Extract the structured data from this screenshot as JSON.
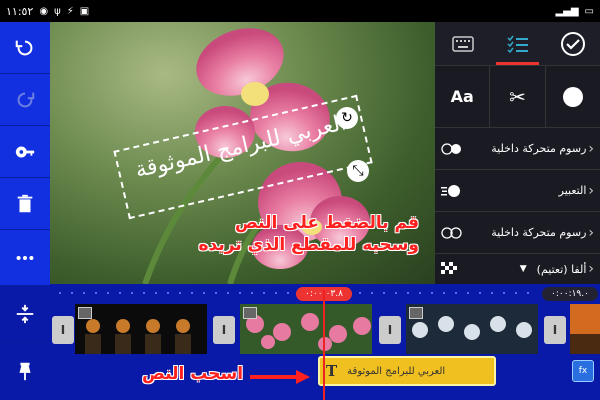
{
  "status_bar": {
    "time": "١١:٥٢",
    "icons": [
      "whatsapp-icon",
      "usb-icon",
      "charging-icon",
      "image-icon"
    ]
  },
  "left_toolbar": {
    "items": [
      "undo-icon",
      "redo-icon",
      "key-icon",
      "trash-icon",
      "more-icon",
      "split-icon",
      "pin-icon"
    ]
  },
  "preview": {
    "overlay_title": "العربي للبرامج الموثوقة",
    "hint_line1": "قم بالضغط على النص",
    "hint_line2": "وسحبه للمقطع الذي تريده"
  },
  "right_panel": {
    "tabs": [
      "keyboard-icon",
      "list-icon",
      "check-icon"
    ],
    "tools": {
      "text": "Aa",
      "cut": "scissors-icon",
      "shape": "circle-icon"
    },
    "options": [
      {
        "label": "رسوم متحركة داخلية",
        "icon": "toggle-icon"
      },
      {
        "label": "التعبير",
        "icon": "speed-icon"
      },
      {
        "label": "رسوم متحركة داخلية",
        "icon": "toggle-icon"
      },
      {
        "label": "ألفا (تعتيم)",
        "icon": "alpha-icon"
      }
    ]
  },
  "timeline": {
    "playhead_time": "٠:٠٠:٠٣.٨",
    "end_time": "٠:٠٠:١٩.٠",
    "text_layer_label": "العربي للبرامج الموثوقة",
    "text_layer_icon": "T",
    "drag_hint": "اسحب النص"
  },
  "colors": {
    "accent": "#1230e0",
    "playhead": "#e22222",
    "text_layer": "#f0c020",
    "hint": "#ff2020"
  }
}
